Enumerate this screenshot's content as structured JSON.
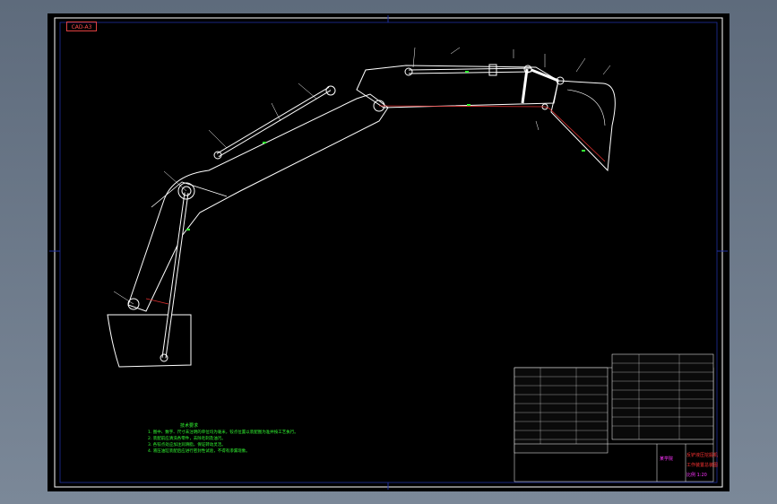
{
  "stamp": {
    "text": "CAD-A3"
  },
  "notes": {
    "title": "技术要求",
    "items": [
      "1. 图中、数字、尺寸未注明的单位均为毫米，铰点位置以装配图为准并按工艺执行。",
      "2. 装配前应清洗各零件，去除毛刺及油污。",
      "3. 各铰点处应加注润滑脂，保证转动灵活。",
      "4. 液压油缸装配后应进行密封性试验，不得有渗漏现象。"
    ]
  },
  "title_block": {
    "drawing_title": "反铲液压挖掘机",
    "subtitle": "工作装置总装图",
    "school": "某学院",
    "sheet_info": "比例 1:20"
  },
  "colors": {
    "line": "#ffffff",
    "red": "#e03030",
    "green": "#33ff33",
    "magenta": "#ff33ff",
    "sheet": "#000000"
  }
}
